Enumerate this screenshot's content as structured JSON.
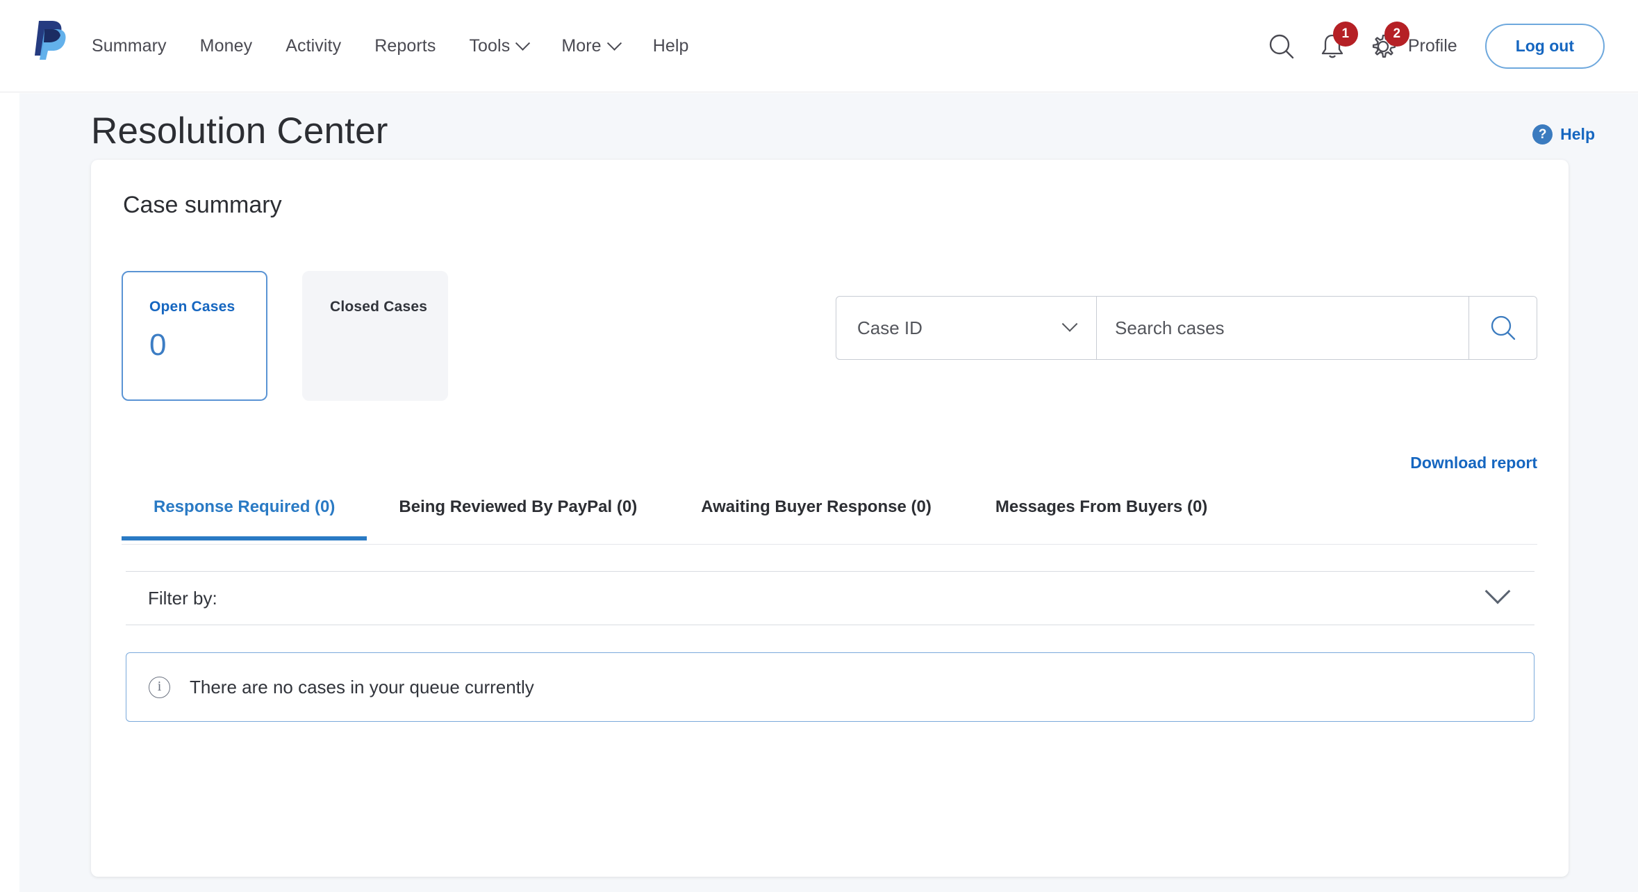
{
  "brand": {
    "logo_icon": "paypal-logo",
    "accent_blue": "#1566c0",
    "tab_blue": "#2a7ac4",
    "badge_red": "#b52025",
    "page_bg": "#f5f7fa"
  },
  "header": {
    "nav_items": [
      {
        "label": "Summary",
        "has_caret": false
      },
      {
        "label": "Money",
        "has_caret": false
      },
      {
        "label": "Activity",
        "has_caret": false
      },
      {
        "label": "Reports",
        "has_caret": false
      },
      {
        "label": "Tools",
        "has_caret": true
      },
      {
        "label": "More",
        "has_caret": true
      },
      {
        "label": "Help",
        "has_caret": false
      }
    ],
    "search_icon": "search-icon",
    "notifications": {
      "icon": "bell-icon",
      "badge": "1"
    },
    "settings": {
      "icon": "gear-icon",
      "badge": "2"
    },
    "profile_label": "Profile",
    "logout_label": "Log out"
  },
  "page": {
    "title": "Resolution Center",
    "help": {
      "icon": "question-mark-icon",
      "label": "Help"
    }
  },
  "case_summary": {
    "heading": "Case summary",
    "tiles": [
      {
        "label": "Open Cases",
        "value": "0",
        "active": true
      },
      {
        "label": "Closed Cases",
        "value": "",
        "active": false
      }
    ]
  },
  "search": {
    "filter_selected": "Case ID",
    "placeholder": "Search cases",
    "value": "",
    "submit_icon": "search-icon",
    "dropdown_icon": "chevron-down-icon"
  },
  "download_report_label": "Download report",
  "tabs": [
    {
      "label": "Response Required (0)",
      "active": true
    },
    {
      "label": "Being Reviewed By PayPal (0)",
      "active": false
    },
    {
      "label": "Awaiting Buyer Response (0)",
      "active": false
    },
    {
      "label": "Messages From Buyers (0)",
      "active": false
    }
  ],
  "filter": {
    "label": "Filter by:",
    "expand_icon": "chevron-down-icon"
  },
  "empty_state": {
    "icon": "info-circle-icon",
    "message": "There are no cases in your queue currently"
  }
}
